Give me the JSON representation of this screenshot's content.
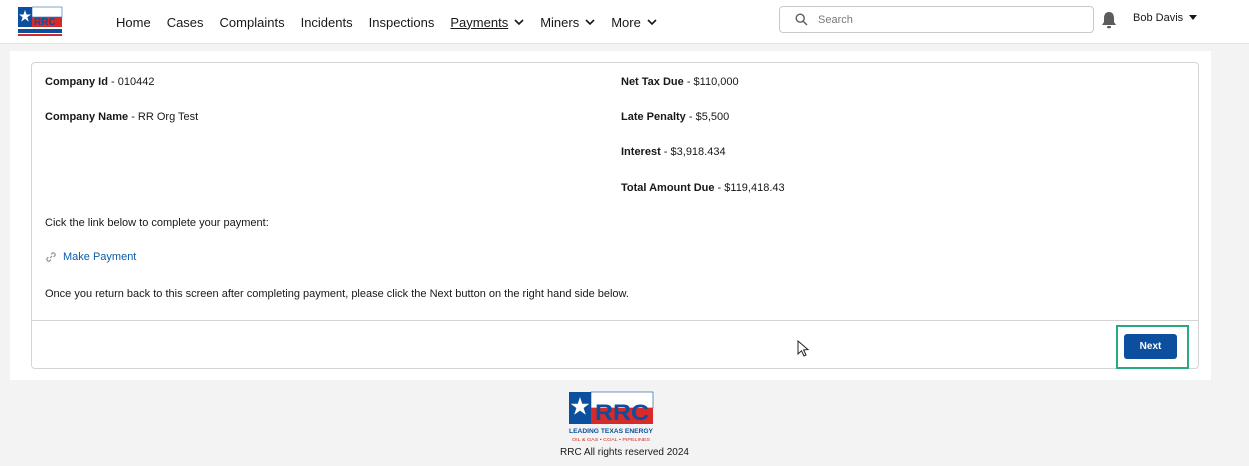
{
  "header": {
    "logo_text": "RRC",
    "nav": [
      {
        "label": "Home",
        "has_menu": false
      },
      {
        "label": "Cases",
        "has_menu": false
      },
      {
        "label": "Complaints",
        "has_menu": false
      },
      {
        "label": "Incidents",
        "has_menu": false
      },
      {
        "label": "Inspections",
        "has_menu": false
      },
      {
        "label": "Payments",
        "has_menu": true,
        "active": true
      },
      {
        "label": "Miners",
        "has_menu": true
      },
      {
        "label": "More",
        "has_menu": true
      }
    ],
    "search_placeholder": "Search",
    "user_name": "Bob Davis"
  },
  "details": {
    "company_id_label": "Company Id",
    "company_id_value": " - 010442",
    "company_name_label": "Company Name",
    "company_name_value": " - RR Org Test",
    "net_tax_label": "Net Tax Due",
    "net_tax_value": " - $110,000",
    "late_penalty_label": "Late Penalty",
    "late_penalty_value": " - $5,500",
    "interest_label": "Interest",
    "interest_value": " - $3,918.434",
    "total_label": "Total Amount Due",
    "total_value": " - $119,418.43"
  },
  "instructions": {
    "link_prompt": "Cick the link below to complete your payment:",
    "link_label": "Make Payment",
    "return_note": "Once you return back to this screen after completing payment, please click the Next button on the right hand side below."
  },
  "actions": {
    "next_label": "Next"
  },
  "footer": {
    "logo_tagline": "LEADING TEXAS ENERGY",
    "logo_subline": "OIL & GAS • COAL • PIPELINES",
    "copyright": "RRC All rights reserved 2024"
  },
  "colors": {
    "brand_blue": "#0b4f9e",
    "brand_red": "#d62b2b",
    "link_blue": "#0b5cab",
    "focus_green": "#2aa87f"
  }
}
